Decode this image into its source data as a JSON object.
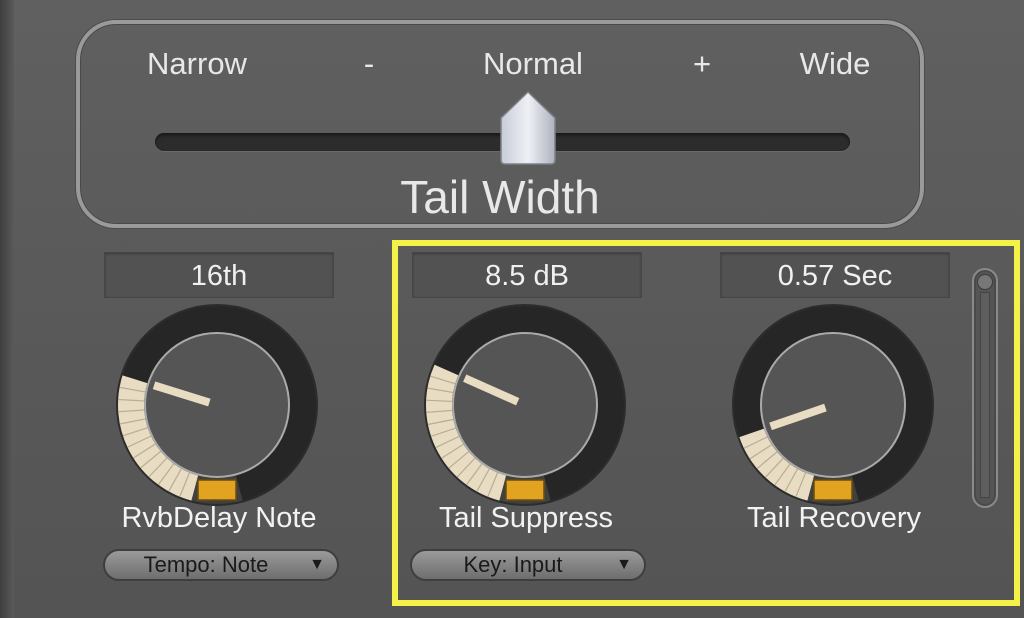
{
  "tail_width": {
    "labels": [
      "Narrow",
      "-",
      "Normal",
      "+",
      "Wide"
    ],
    "title": "Tail Width",
    "value_fraction": 0.5
  },
  "rvbdelay": {
    "value": "16th",
    "label": "RvbDelay Note",
    "level": 0.28,
    "dropdown": "Tempo: Note"
  },
  "tail_suppress": {
    "value": "8.5 dB",
    "label": "Tail Suppress",
    "level": 0.3,
    "dropdown": "Key: Input"
  },
  "tail_recovery": {
    "value": "0.57 Sec",
    "label": "Tail Recovery",
    "level": 0.17
  },
  "colors": {
    "highlight": "#f4f148",
    "knob_fill": "#e8dcc2",
    "knob_center": "#e2a321"
  },
  "icons": {
    "dropdown_arrow": "▼"
  }
}
